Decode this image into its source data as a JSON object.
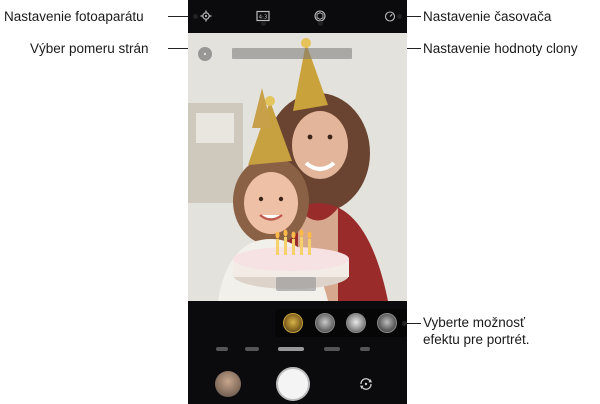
{
  "callouts": {
    "camera_settings": "Nastavenie fotoaparátu",
    "aspect_ratio": "Výber pomeru strán",
    "timer": "Nastavenie časovača",
    "aperture": "Nastavenie hodnoty clony",
    "portrait_effect_line1": "Vyberte možnosť",
    "portrait_effect_line2": "efektu pre portrét."
  },
  "icons": {
    "settings": "gear-icon",
    "aspect_ratio": "aspect-ratio-icon",
    "aperture": "aperture-icon",
    "timer": "timer-icon",
    "switch_camera": "switch-camera-icon"
  },
  "colors": {
    "phone_background": "#0b0b0d",
    "callout_text": "#1a1a1a",
    "shutter": "#f4f4f4"
  }
}
